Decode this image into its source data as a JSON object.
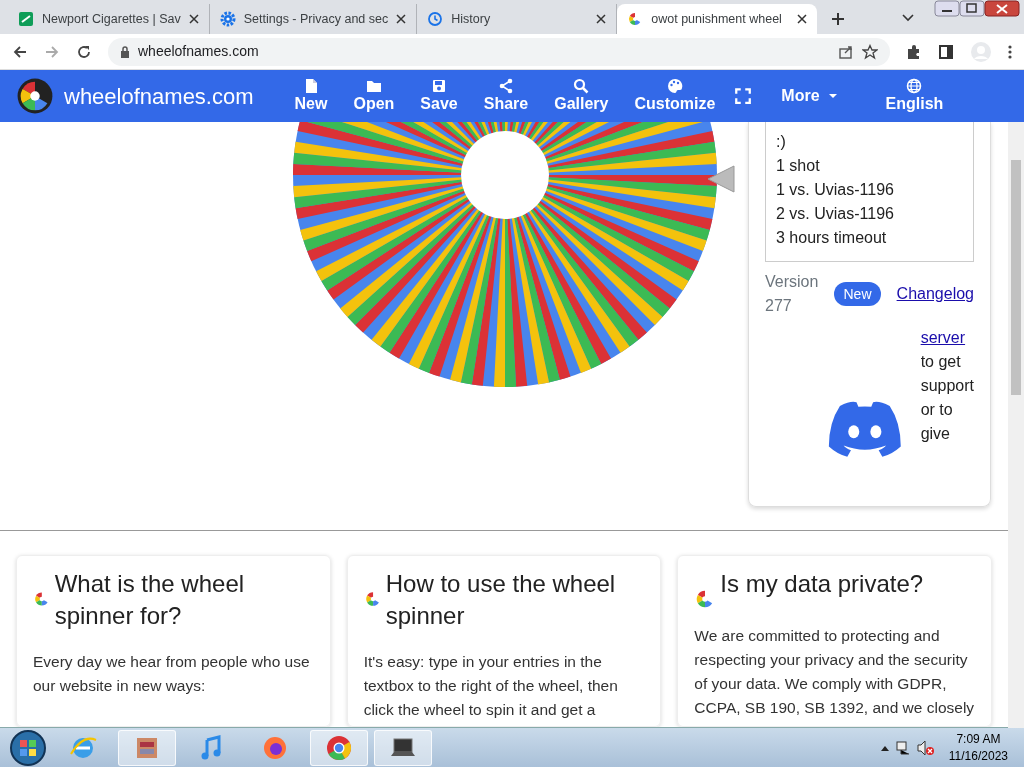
{
  "browser": {
    "tabs": [
      {
        "title": "Newport Cigarettes | Sav",
        "selected": false
      },
      {
        "title": "Settings - Privacy and sec",
        "selected": false
      },
      {
        "title": "History",
        "selected": false
      },
      {
        "title": "owot punishment wheel",
        "selected": true
      }
    ],
    "address": "wheelofnames.com"
  },
  "site": {
    "brand": "wheelofnames.com",
    "nav": [
      {
        "label": "New",
        "kind": "button"
      },
      {
        "label": "Open",
        "kind": "button"
      },
      {
        "label": "Save",
        "kind": "button"
      },
      {
        "label": "Share",
        "kind": "button"
      },
      {
        "label": "Gallery",
        "kind": "button"
      },
      {
        "label": "Customize",
        "kind": "button"
      },
      {
        "label": "More",
        "kind": "dropdown"
      },
      {
        "label": "English",
        "kind": "language"
      }
    ]
  },
  "entries": [
    ":)",
    "1 shot",
    "1 vs. Uvias-1196",
    "2 vs. Uvias-1196",
    "3 hours timeout"
  ],
  "version": {
    "label": "Version",
    "number": "277",
    "badge": "New",
    "link": "Changelog"
  },
  "discord": {
    "link": "server",
    "text": "to get support or to give"
  },
  "info_cards": [
    {
      "title": "What is the wheel spinner for?",
      "body": "Every day we hear from people who use our website in new ways:"
    },
    {
      "title": "How to use the wheel spinner",
      "body": "It's easy: type in your entries in the textbox to the right of the wheel, then click the wheel to spin it and get a"
    },
    {
      "title": "Is my data private?",
      "body": "We are committed to protecting and respecting your privacy and the security of your data. We comply with GDPR, CCPA, SB 190, SB 1392, and we closely"
    }
  ],
  "taskbar": {
    "apps": [
      {
        "active": false
      },
      {
        "active": true
      },
      {
        "active": false
      },
      {
        "active": false
      },
      {
        "active": true
      },
      {
        "active": true
      }
    ],
    "time": "7:09 AM",
    "date": "11/16/2023"
  }
}
